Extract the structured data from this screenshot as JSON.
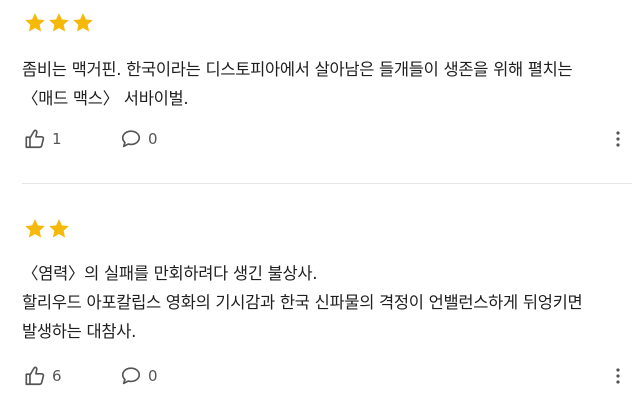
{
  "colors": {
    "star": "#F5B90A",
    "icon": "#555555",
    "text": "#1F1F1F",
    "divider": "#E6E6E6"
  },
  "reviews": [
    {
      "rating": 3,
      "lines": [
        "좀비는 맥거핀. 한국이라는 디스토피아에서 살아남은 들개들이 생존을 위해 펼치는",
        "〈매드 맥스〉 서바이벌."
      ],
      "likes": "1",
      "comments": "0",
      "icons": {
        "like": "thumbs-up-icon",
        "comment": "speech-bubble-icon",
        "more": "more-vertical-icon"
      }
    },
    {
      "rating": 2,
      "lines": [
        "〈염력〉의 실패를 만회하려다 생긴 불상사.",
        "할리우드 아포칼립스 영화의 기시감과 한국 신파물의 격정이 언밸런스하게 뒤엉키면",
        "발생하는 대참사."
      ],
      "likes": "6",
      "comments": "0",
      "icons": {
        "like": "thumbs-up-icon",
        "comment": "speech-bubble-icon",
        "more": "more-vertical-icon"
      }
    }
  ]
}
